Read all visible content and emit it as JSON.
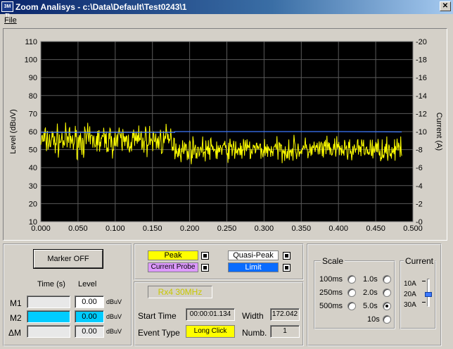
{
  "window": {
    "title": "Zoom Analisys - c:\\Data\\Default\\Test0243\\1",
    "icon_text": "3M TI",
    "close_symbol": "✕"
  },
  "menu": {
    "file": "File"
  },
  "colors": {
    "plot_bg": "#000000",
    "trace_peak": "#ffff00",
    "trace_limit": "#3c78ff",
    "limit_fill": "#0a6cff",
    "marker_m2": "#00ccff",
    "peak_fill": "#ffff00",
    "current_probe_fill": "#dd99ff"
  },
  "chart_data": {
    "type": "line",
    "xlim": [
      0,
      0.5
    ],
    "x_ticks": [
      "0.000",
      "0.050",
      "0.100",
      "0.150",
      "0.200",
      "0.250",
      "0.300",
      "0.350",
      "0.400",
      "0.450",
      "0.500"
    ],
    "ylim": [
      10,
      110
    ],
    "y_ticks": [
      "110",
      "100",
      "90",
      "80",
      "70",
      "60",
      "50",
      "40",
      "30",
      "20",
      "10"
    ],
    "y2lim": [
      0,
      20
    ],
    "y2_ticks": [
      "-20",
      "-18",
      "-16",
      "-14",
      "-12",
      "-10",
      "-8",
      "-6",
      "-4",
      "-2",
      "-0"
    ],
    "ylabel": "Level (dBuV)",
    "y2label": "Current (A)",
    "grid": true,
    "series": [
      {
        "name": "Peak",
        "color": "#ffff00",
        "x_range": [
          0,
          0.485
        ],
        "segments": [
          {
            "x": [
              0,
              0.18
            ],
            "mean": 55,
            "spread": 9
          },
          {
            "x": [
              0.18,
              0.485
            ],
            "mean": 50,
            "spread": 7
          }
        ]
      },
      {
        "name": "Limit",
        "color": "#3c78ff",
        "points": [
          [
            0,
            59.5
          ],
          [
            0.18,
            59.5
          ],
          [
            0.18,
            60
          ],
          [
            0.4,
            60
          ],
          [
            0.485,
            59.8
          ]
        ]
      }
    ]
  },
  "marker": {
    "button": "Marker OFF",
    "col_time": "Time (s)",
    "col_level": "Level",
    "rows": [
      {
        "label": "M1",
        "time": "",
        "level": "0.00",
        "unit": "dBuV"
      },
      {
        "label": "M2",
        "time": "",
        "level": "0.00",
        "unit": "dBuV"
      },
      {
        "label": "ΔM",
        "time": "",
        "level": "0.00",
        "unit": "dBuV"
      }
    ]
  },
  "legend": {
    "peak": "Peak",
    "current_probe": "Current Probe",
    "quasi_peak": "Quasi-Peak",
    "limit": "Limit"
  },
  "event": {
    "rx": "Rx4 30MHz",
    "start_time_label": "Start Time",
    "start_time": "00:00:01.134",
    "width_label": "Width",
    "width": "172.042",
    "event_type_label": "Event Type",
    "event_type": "Long Click",
    "numb_label": "Numb.",
    "numb": "1"
  },
  "scale": {
    "title": "Scale",
    "options": [
      "100ms",
      "250ms",
      "500ms",
      "1.0s",
      "2.0s",
      "5.0s",
      "10s"
    ],
    "selected": "5.0s"
  },
  "current": {
    "title": "Current",
    "options": [
      "10A",
      "20A",
      "30A"
    ],
    "selected": "20A"
  }
}
